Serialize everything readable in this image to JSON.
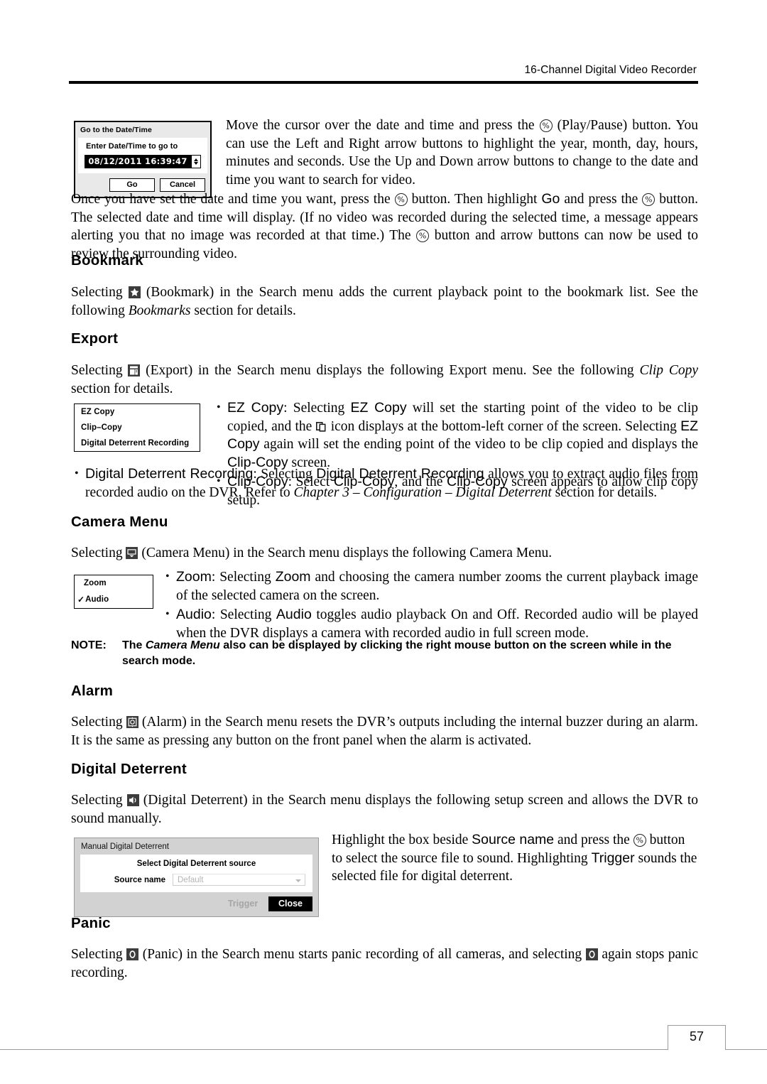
{
  "header": {
    "title": "16-Channel Digital Video Recorder"
  },
  "goto_dialog": {
    "title": "Go to the Date/Time",
    "subtitle": "Enter Date/Time to go to",
    "datetime_value": "08/12/2011  16:39:47",
    "go_label": "Go",
    "cancel_label": "Cancel"
  },
  "intro": {
    "p1_a": "Move the cursor over the date and time and press the ",
    "p1_b": " (Play/Pause) button.  You can use the Left and Right arrow buttons to highlight the year, month, day, hours, minutes and seconds.  Use the Up and Down arrow buttons to change to the date and time you want to search for video.",
    "p2_a": "Once you have set the date and time you want, press the ",
    "p2_b": " button.  Then highlight ",
    "p2_go": "Go",
    "p2_c": " and press the ",
    "p2_d": " button.  The selected date and time will display.  (If no video was recorded during the selected time, a message appears alerting you that no image was recorded at that time.)  The ",
    "p2_e": " button and arrow buttons can now be used to review the surrounding video."
  },
  "bookmark": {
    "heading": "Bookmark",
    "text_a": "Selecting ",
    "text_b": " (Bookmark) in the Search menu adds the current playback point to the bookmark list.  See the following ",
    "text_italic": "Bookmarks",
    "text_c": " section for details."
  },
  "export": {
    "heading": "Export",
    "text_a": "Selecting ",
    "text_b": " (Export) in the Search menu displays the following Export menu.  See the following ",
    "text_italic": "Clip Copy",
    "text_c": " section for details.",
    "menu_items": [
      "EZ Copy",
      "Clip–Copy",
      "Digital Deterrent Recording"
    ],
    "bullets": {
      "ez_label": "EZ Copy",
      "ez_a": ":  Selecting ",
      "ez_b": "EZ Copy",
      "ez_c": " will set the starting point of the video to be clip copied, and the ",
      "ez_d": " icon displays at the bottom-left corner of the screen.  Selecting ",
      "ez_e": "EZ Copy",
      "ez_f": " again will set the ending point of the video to be clip copied and displays the ",
      "ez_g": "Clip-Copy",
      "ez_h": " screen.",
      "clip_label": "Clip-Copy",
      "clip_a": ":  Select ",
      "clip_b": "Clip-Copy",
      "clip_c": ", and the ",
      "clip_d": "Clip-Copy",
      "clip_e": " screen appears to allow clip copy setup.",
      "ddr_label": "Digital Deterrent Recording",
      "ddr_a": ":  Selecting ",
      "ddr_b": "Digital Deterrent Recording",
      "ddr_c": " allows you to extract audio files from recorded audio on the DVR.  Refer to ",
      "ddr_italic": "Chapter 3 – Configuration – Digital Deterrent",
      "ddr_d": " section for details."
    }
  },
  "camera_menu": {
    "heading": "Camera Menu",
    "text_a": "Selecting ",
    "text_b": " (Camera Menu) in the Search menu displays the following Camera Menu.",
    "menu_items": [
      "Zoom",
      "Audio"
    ],
    "audio_check": "✓",
    "bullets": {
      "zoom_label": "Zoom",
      "zoom_a": ":  Selecting ",
      "zoom_b": "Zoom",
      "zoom_c": " and choosing the camera number zooms the current playback image of the selected camera on the screen.",
      "audio_label": "Audio",
      "audio_a": ":  Selecting ",
      "audio_b": "Audio",
      "audio_c": " toggles audio playback On and Off.  Recorded audio will be played when the DVR displays a camera with recorded audio in full screen mode."
    },
    "note_label": "NOTE:",
    "note_a": "The ",
    "note_italic": "Camera Menu",
    "note_b": " also can be displayed by clicking the right mouse button on the screen while in the search mode."
  },
  "alarm": {
    "heading": "Alarm",
    "text_a": "Selecting ",
    "text_b": " (Alarm) in the Search menu resets the DVR’s outputs including the internal buzzer during an alarm.  It is the same as pressing any button on the front panel when the alarm is activated."
  },
  "digital_deterrent": {
    "heading": "Digital Deterrent",
    "text_a": "Selecting ",
    "text_b": " (Digital Deterrent) in the Search menu displays the following setup screen and allows the DVR to sound manually.",
    "dialog": {
      "title": "Manual Digital Deterrent",
      "subtitle": "Select Digital Deterrent source",
      "source_label": "Source name",
      "source_value": "Default",
      "trigger_label": "Trigger",
      "close_label": "Close"
    },
    "side_text_a": "Highlight the box beside ",
    "side_source": "Source name",
    "side_text_b": " and press the ",
    "side_text_c": " button to select the source file to sound.  Highlighting ",
    "side_trigger": "Trigger",
    "side_text_d": " sounds the selected file for digital deterrent."
  },
  "panic": {
    "heading": "Panic",
    "text_a": "Selecting ",
    "text_b": " (Panic) in the Search menu starts panic recording of all cameras, and selecting ",
    "text_c": " again stops panic recording."
  },
  "footer": {
    "page_number": "57"
  }
}
